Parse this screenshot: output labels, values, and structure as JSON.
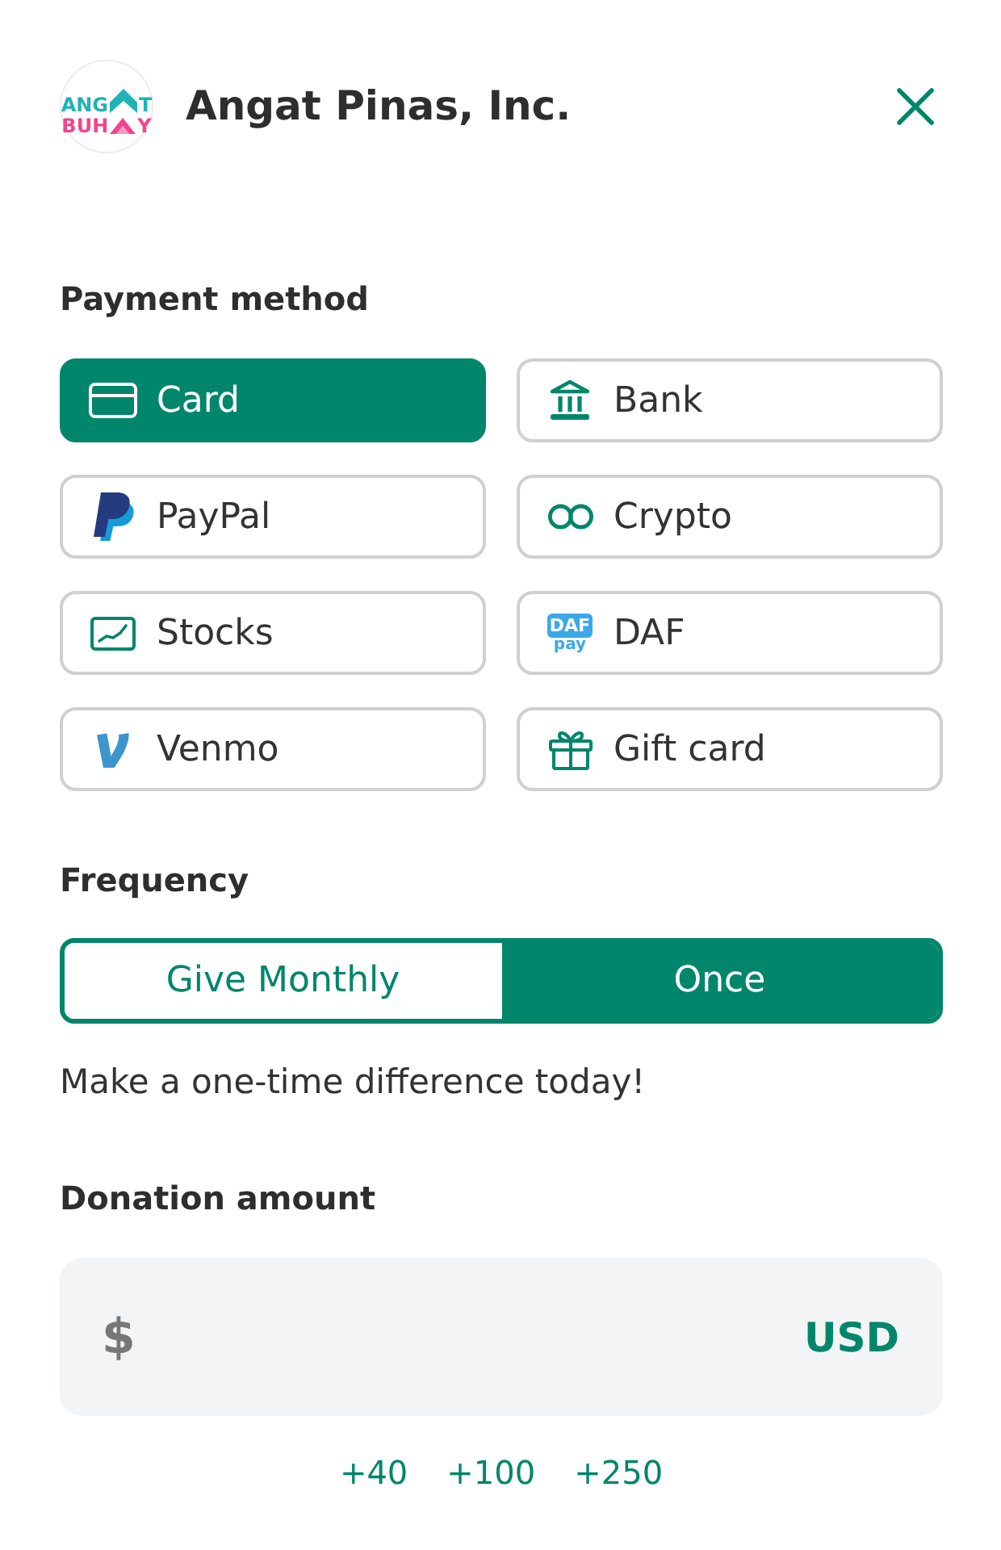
{
  "header": {
    "logo": {
      "top": [
        "ANG",
        "T"
      ],
      "bottom": [
        "BUH",
        "Y"
      ]
    },
    "title": "Angat Pinas, Inc."
  },
  "payment_method": {
    "label": "Payment method",
    "options": [
      {
        "label": "Card",
        "kind": "card",
        "selected": true
      },
      {
        "label": "Bank",
        "kind": "bank",
        "selected": false
      },
      {
        "label": "PayPal",
        "kind": "paypal",
        "selected": false
      },
      {
        "label": "Crypto",
        "kind": "crypto",
        "selected": false
      },
      {
        "label": "Stocks",
        "kind": "stocks",
        "selected": false
      },
      {
        "label": "DAF",
        "kind": "daf",
        "selected": false,
        "icon_text": [
          "DAF",
          "pay"
        ]
      },
      {
        "label": "Venmo",
        "kind": "venmo",
        "selected": false
      },
      {
        "label": "Gift card",
        "kind": "gift",
        "selected": false
      }
    ]
  },
  "frequency": {
    "label": "Frequency",
    "options": [
      {
        "label": "Give Monthly",
        "selected": false
      },
      {
        "label": "Once",
        "selected": true
      }
    ],
    "note": "Make a one-time difference today!"
  },
  "donation_amount": {
    "label": "Donation amount",
    "symbol": "$",
    "currency": "USD",
    "presets": [
      "+40",
      "+100",
      "+250"
    ]
  }
}
